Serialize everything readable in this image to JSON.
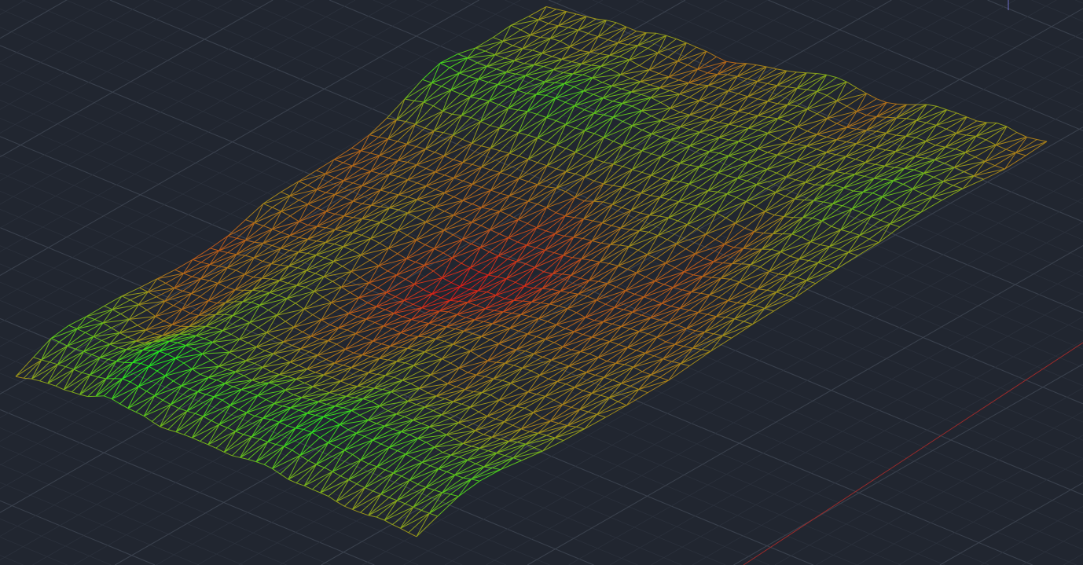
{
  "viewport": {
    "mode": "3D wireframe",
    "background_color": "#212630"
  },
  "grid": {
    "visible": true,
    "minor_color": "#2b313c",
    "major_color": "#3a414d"
  },
  "ucs_axes": {
    "x_axis_color": "#9b2a2a",
    "y_axis_color": "#6f6fc8"
  },
  "surface": {
    "object_type": "triangulated terrain mesh",
    "style": "wireframe",
    "colors": {
      "high": "#1ef01e",
      "mid": "#9a9a1a",
      "low": "#e01818"
    }
  }
}
